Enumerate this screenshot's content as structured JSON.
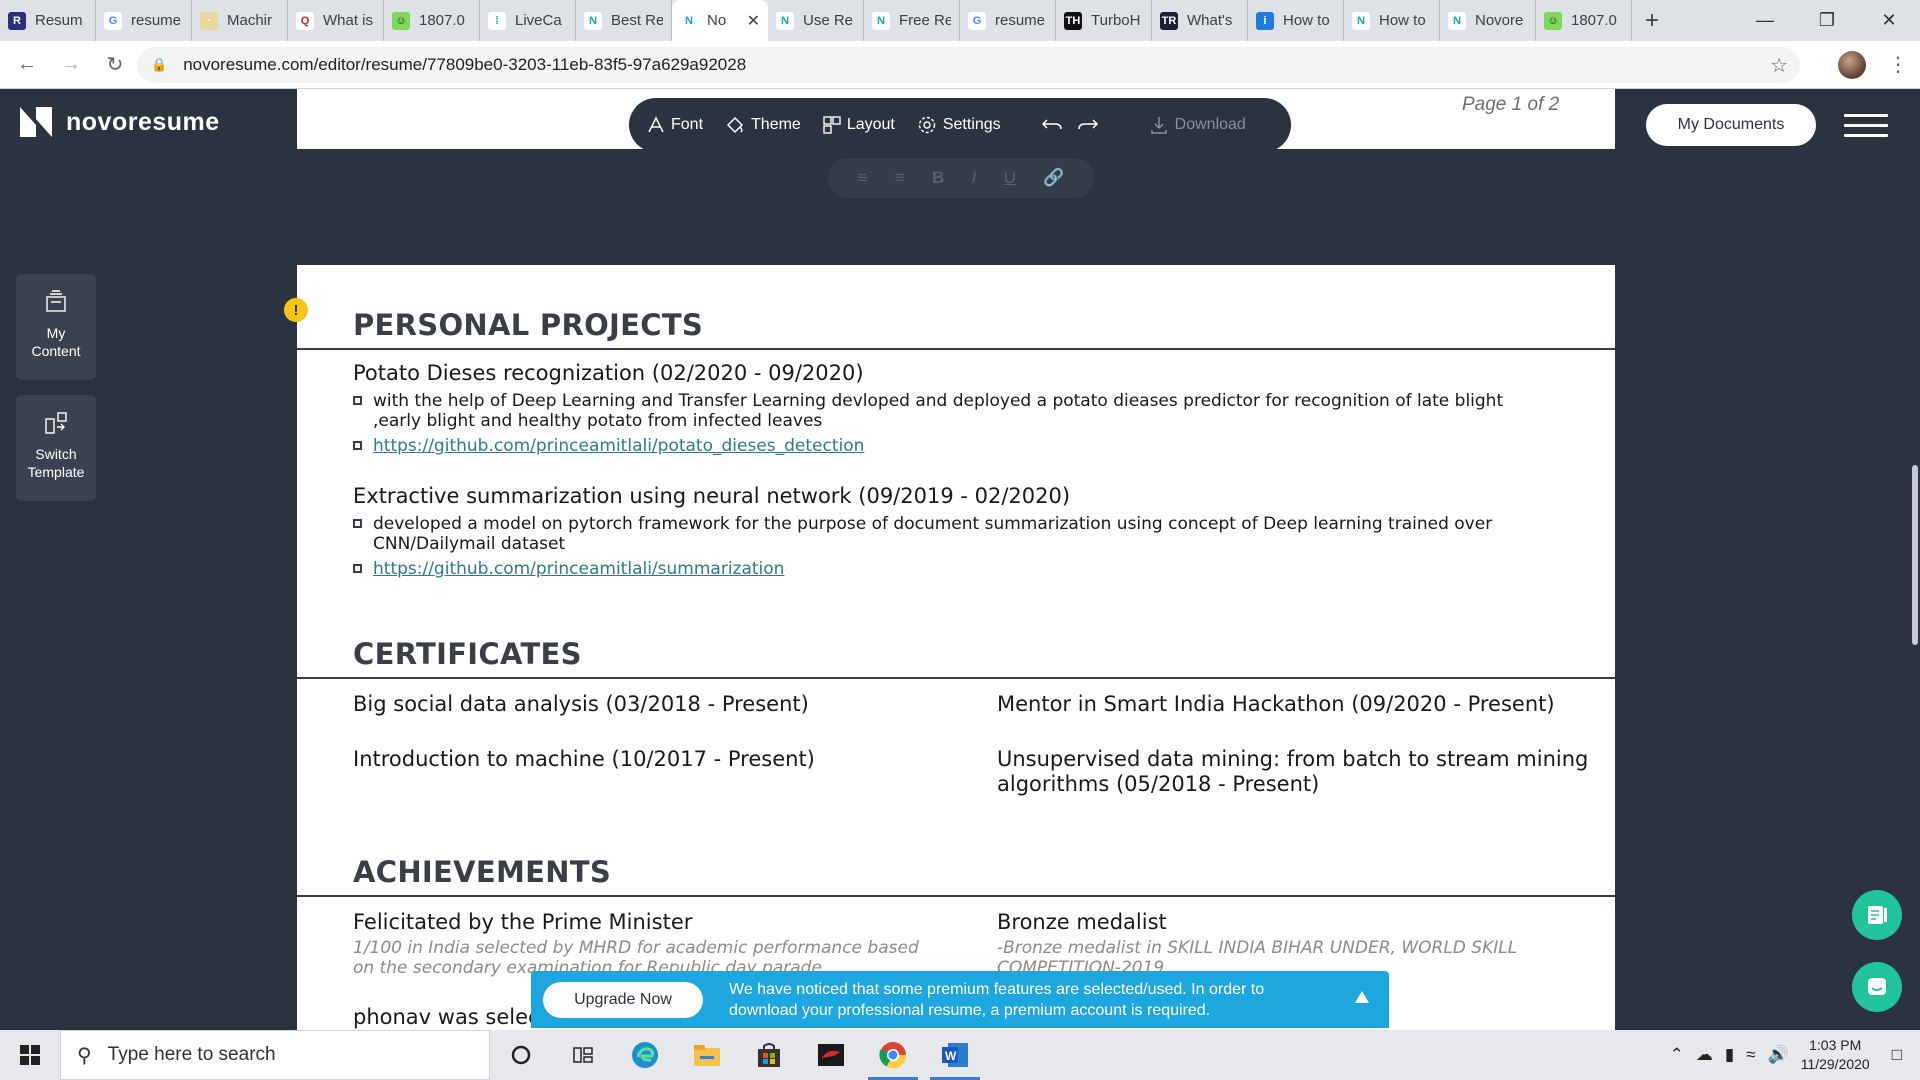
{
  "browser": {
    "tabs": [
      {
        "label": "Resum",
        "fav_bg": "#2b2f77",
        "fav_txt": "R"
      },
      {
        "label": "resume",
        "fav_bg": "#ffffff",
        "fav_txt": "G"
      },
      {
        "label": "Machir",
        "fav_bg": "#e9d6a0",
        "fav_txt": "·"
      },
      {
        "label": "What is",
        "fav_bg": "#ffffff",
        "fav_txt": "Q"
      },
      {
        "label": "1807.0",
        "fav_bg": "#7dd957",
        "fav_txt": "☺"
      },
      {
        "label": "LiveCa",
        "fav_bg": "#ffffff",
        "fav_txt": "⁞"
      },
      {
        "label": "Best Re",
        "fav_bg": "#ffffff",
        "fav_txt": "N"
      },
      {
        "label": "No",
        "fav_bg": "#ffffff",
        "fav_txt": "N",
        "active": true
      },
      {
        "label": "Use Re",
        "fav_bg": "#ffffff",
        "fav_txt": "N"
      },
      {
        "label": "Free Re",
        "fav_bg": "#ffffff",
        "fav_txt": "N"
      },
      {
        "label": "resume",
        "fav_bg": "#ffffff",
        "fav_txt": "G"
      },
      {
        "label": "TurboH",
        "fav_bg": "#111111",
        "fav_txt": "TH"
      },
      {
        "label": "What's",
        "fav_bg": "#1b1f3a",
        "fav_txt": "TR"
      },
      {
        "label": "How to",
        "fav_bg": "#1e7be0",
        "fav_txt": "i"
      },
      {
        "label": "How to",
        "fav_bg": "#ffffff",
        "fav_txt": "N"
      },
      {
        "label": "Novore",
        "fav_bg": "#ffffff",
        "fav_txt": "N"
      },
      {
        "label": "1807.0",
        "fav_bg": "#7dd957",
        "fav_txt": "☺"
      }
    ],
    "url": "novoresume.com/editor/resume/77809be0-3203-11eb-83f5-97a629a92028"
  },
  "app": {
    "brand": "novoresume",
    "page_indicator": "Page 1 of 2",
    "toolbar": {
      "font": "Font",
      "theme": "Theme",
      "layout": "Layout",
      "settings": "Settings",
      "download": "Download"
    },
    "my_documents": "My Documents",
    "sidebar": {
      "my_content_1": "My",
      "my_content_2": "Content",
      "switch_1": "Switch",
      "switch_2": "Template"
    },
    "accent": "#2c3340",
    "link_color": "#2d7c8a"
  },
  "resume": {
    "projects": {
      "title": "PERSONAL PROJECTS",
      "p1_title": "Potato Dieses recognization (02/2020 - 09/2020)",
      "p1_b1": "with the help of Deep Learning and Transfer Learning devloped and deployed a potato dieases predictor for recognition of late blight ,early blight and healthy potato from infected leaves",
      "p1_link": "https://github.com/princeamitlali/potato_dieses_detection",
      "p2_title": "Extractive summarization using neural network (09/2019 - 02/2020)",
      "p2_b1": "developed a model on pytorch framework for the purpose of document summarization using concept of Deep learning trained over CNN/Dailymail dataset",
      "p2_link": "https://github.com/princeamitlali/summarization"
    },
    "certificates": {
      "title": "CERTIFICATES",
      "c1": "Big social data analysis (03/2018 - Present)",
      "c2": "Mentor in Smart India Hackathon (09/2020 - Present)",
      "c3": "Introduction to machine (10/2017 - Present)",
      "c4_l1": "Unsupervised data mining: from batch to stream mining",
      "c4_l2": "algorithms (05/2018 - Present)"
    },
    "achievements": {
      "title": "ACHIEVEMENTS",
      "a1_title": "Felicitated by the Prime Minister",
      "a1_desc": "1/100 in India selected by MHRD for academic performance based on the secondary examination for Republic day parade",
      "a2_title": "Bronze medalist",
      "a2_desc": "-Bronze medalist in SKILL INDIA BIHAR UNDER, WORLD SKILL COMPETITION-2019",
      "a3_title": "phonav was selec"
    }
  },
  "upgrade": {
    "button": "Upgrade Now",
    "message": "We have noticed that some premium features are selected/used. In order to download your professional resume, a premium account is required."
  },
  "taskbar": {
    "search_placeholder": "Type here to search",
    "time": "1:03 PM",
    "date": "11/29/2020"
  }
}
